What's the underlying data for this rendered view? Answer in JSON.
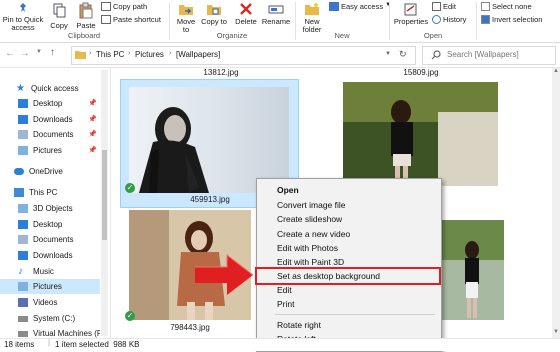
{
  "ribbon": {
    "clipboard": {
      "pin_label": "Pin to Quick access",
      "copy_label": "Copy",
      "paste_label": "Paste",
      "copy_path_label": "Copy path",
      "paste_shortcut_label": "Paste shortcut",
      "group_label": "Clipboard"
    },
    "organize": {
      "move_to_label": "Move to",
      "copy_to_label": "Copy to",
      "delete_label": "Delete",
      "rename_label": "Rename",
      "group_label": "Organize"
    },
    "new": {
      "new_folder_label": "New folder",
      "easy_access_label": "Easy access",
      "group_label": "New"
    },
    "open": {
      "properties_label": "Properties",
      "edit_label": "Edit",
      "history_label": "History",
      "group_label": "Open"
    },
    "select": {
      "select_none_label": "Select none",
      "invert_selection_label": "Invert selection"
    }
  },
  "address": {
    "path": [
      "This PC",
      "Pictures",
      "[Wallpapers]"
    ],
    "search_placeholder": "Search [Wallpapers]"
  },
  "nav": {
    "items": [
      {
        "label": "Quick access",
        "pinned": false
      },
      {
        "label": "Desktop",
        "pinned": true
      },
      {
        "label": "Downloads",
        "pinned": true
      },
      {
        "label": "Documents",
        "pinned": true
      },
      {
        "label": "Pictures",
        "pinned": true
      },
      {
        "label": "OneDrive",
        "pinned": false
      },
      {
        "label": "This PC",
        "pinned": false
      },
      {
        "label": "3D Objects",
        "pinned": false
      },
      {
        "label": "Desktop",
        "pinned": false
      },
      {
        "label": "Documents",
        "pinned": false
      },
      {
        "label": "Downloads",
        "pinned": false
      },
      {
        "label": "Music",
        "pinned": false
      },
      {
        "label": "Pictures",
        "pinned": false,
        "selected": true
      },
      {
        "label": "Videos",
        "pinned": false
      },
      {
        "label": "System (C:)",
        "pinned": false
      },
      {
        "label": "Virtual Machines (F",
        "pinned": false
      }
    ]
  },
  "files": {
    "top_names": [
      "13812.jpg",
      "15809.jpg"
    ],
    "items": [
      {
        "name": "459913.jpg",
        "selected": true
      },
      {
        "name": "798443.jpg",
        "selected": false
      }
    ]
  },
  "context_menu": {
    "items": [
      {
        "label": "Open",
        "bold": true
      },
      {
        "label": "Convert image file"
      },
      {
        "label": "Create slideshow"
      },
      {
        "label": "Create a new video"
      },
      {
        "label": "Edit with Photos"
      },
      {
        "label": "Edit with Paint 3D"
      },
      {
        "label": "Set as desktop background",
        "highlighted": true
      },
      {
        "label": "Edit"
      },
      {
        "label": "Print"
      },
      {
        "label": "Rotate right"
      },
      {
        "label": "Rotate left"
      }
    ]
  },
  "status": {
    "item_count": "18 items",
    "selection": "1 item selected  988 KB"
  },
  "colors": {
    "accent": "#0078d7",
    "selection": "#cce8ff",
    "highlight_box": "#e02020",
    "arrow": "#e02020",
    "check": "#2ea043"
  }
}
